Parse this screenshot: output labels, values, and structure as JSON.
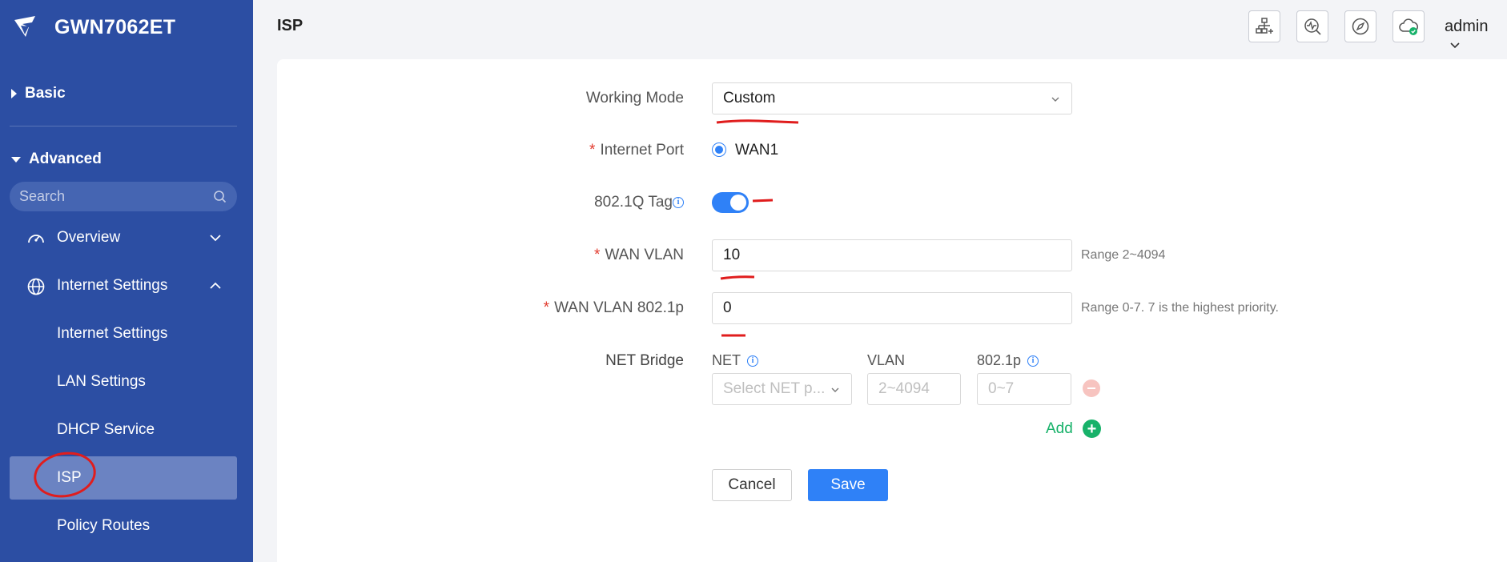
{
  "sidebar": {
    "brand": "GWN7062ET",
    "basic_label": "Basic",
    "advanced_label": "Advanced",
    "search_placeholder": "Search",
    "overview_label": "Overview",
    "internet_settings_label": "Internet Settings",
    "sub_items": [
      "Internet Settings",
      "LAN Settings",
      "DHCP Service",
      "ISP",
      "Policy Routes"
    ],
    "active_item": "ISP"
  },
  "header": {
    "title": "ISP",
    "user": "admin",
    "icons": [
      "network-add-icon",
      "diagnostics-icon",
      "compass-icon",
      "cloud-check-icon"
    ]
  },
  "form": {
    "working_mode": {
      "label": "Working Mode",
      "value": "Custom"
    },
    "internet_port": {
      "label": "Internet Port",
      "option": "WAN1",
      "selected": true
    },
    "tag_8021q": {
      "label": "802.1Q Tag",
      "enabled": true
    },
    "wan_vlan": {
      "label": "WAN VLAN",
      "value": "10",
      "hint": "Range 2~4094"
    },
    "wan_vlan_8021p": {
      "label": "WAN VLAN 802.1p",
      "value": "0",
      "hint": "Range 0-7. 7 is the highest priority."
    },
    "net_bridge": {
      "label": "NET Bridge",
      "net_header": "NET",
      "vlan_header": "VLAN",
      "p_header": "802.1p",
      "net_placeholder": "Select NET p...",
      "vlan_placeholder": "2~4094",
      "p_placeholder": "0~7",
      "add_label": "Add"
    },
    "cancel_label": "Cancel",
    "save_label": "Save"
  },
  "colors": {
    "sidebar_bg": "#2c4ea3",
    "active_item_bg": "#6b83c2",
    "primary": "#2f81f7",
    "add_green": "#18b26a",
    "required_red": "#e23b2e",
    "annotation_red": "#e01d1d"
  }
}
